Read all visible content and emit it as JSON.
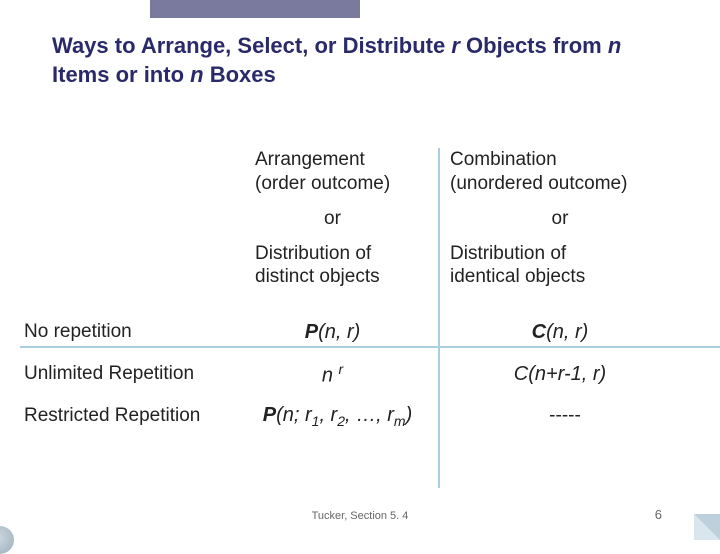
{
  "title": {
    "prefix": "Ways to Arrange, Select, or Distribute ",
    "r": "r ",
    "mid": " Objects from ",
    "n1": "n ",
    "mid2": "Items or into ",
    "n2": "n ",
    "suffix": "Boxes"
  },
  "headers": {
    "arrangement_l1": "Arrangement",
    "arrangement_l2": "(order outcome)",
    "combination_l1": "Combination",
    "combination_l2": "(unordered outcome)",
    "or": "or",
    "dist_distinct_l1": "Distribution of",
    "dist_distinct_l2": "distinct objects",
    "dist_identical_l1": "Distribution of",
    "dist_identical_l2": "identical objects"
  },
  "rows": {
    "no_rep": {
      "label": "No repetition",
      "arr_prefix": "P",
      "arr_args": "(n, r)",
      "comb_prefix": "C",
      "comb_args": "(n, r)"
    },
    "unlimited": {
      "label": "Unlimited Repetition",
      "arr_base": "n ",
      "arr_sup": "r",
      "comb": "C(n+r-1, r)"
    },
    "restricted": {
      "label": "Restricted Repetition",
      "arr_prefix": "P",
      "arr_open": "(n; r",
      "arr_s1": "1",
      "arr_sep1": ", r",
      "arr_s2": "2",
      "arr_sep2": ", …, r",
      "arr_sm": "m",
      "arr_close": ")",
      "comb": "-----"
    }
  },
  "footer": {
    "cite": "Tucker, Section 5. 4",
    "page": "6"
  }
}
